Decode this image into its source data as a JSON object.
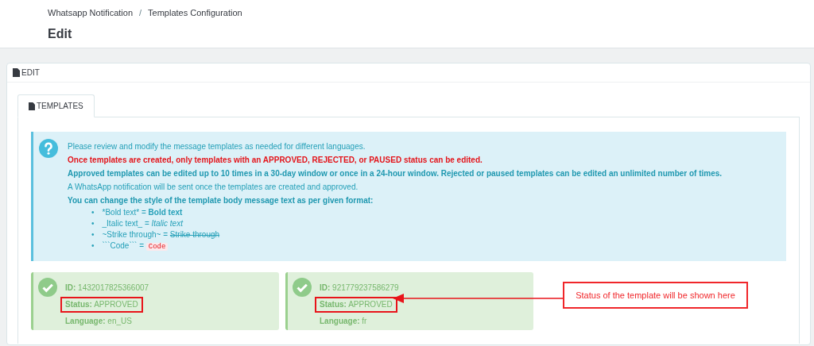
{
  "breadcrumb": [
    "Whatsapp Notification",
    "/",
    "Templates Configuration"
  ],
  "page_title": "Edit",
  "panel": {
    "title": "EDIT"
  },
  "tabs": [
    {
      "label": "TEMPLATES",
      "selected": true
    }
  ],
  "info": {
    "lines": [
      {
        "kind": "plain",
        "text": "Please review and modify the message templates as needed for different languages."
      },
      {
        "kind": "warning",
        "text": "Once templates are created, only templates with an APPROVED, REJECTED, or PAUSED status can be edited."
      },
      {
        "kind": "emphasis",
        "text": "Approved templates can be edited up to 10 times in a 30-day window or once in a 24-hour window. Rejected or paused templates can be edited an unlimited number of times."
      },
      {
        "kind": "plain",
        "text": "A WhatsApp notification will be sent once the templates are created and approved."
      },
      {
        "kind": "emphasis",
        "text": "You can change the style of the template body message text as per given format:"
      }
    ],
    "formats": [
      {
        "bullet": "•",
        "kind": "bold",
        "source": "*Bold text* =",
        "result": "Bold text"
      },
      {
        "bullet": "•",
        "kind": "italic",
        "source": "_Italic text_ =",
        "result": "Italic text"
      },
      {
        "bullet": "•",
        "kind": "strike",
        "source": "~Strike through~ =",
        "result": "Strike through"
      },
      {
        "bullet": "•",
        "kind": "code",
        "source": "```Code``` =",
        "result": "Code"
      }
    ]
  },
  "templates": [
    {
      "id_label": "ID:",
      "id": "1432017825366007",
      "status_label": "Status:",
      "status": "APPROVED",
      "language_label": "Language:",
      "language": "en_US",
      "highlighted": true
    },
    {
      "id_label": "ID:",
      "id": "921779237586279",
      "status_label": "Status:",
      "status": "APPROVED",
      "language_label": "Language:",
      "language": "fr",
      "highlighted": true
    }
  ],
  "annotation": {
    "text": "Status of the template will be shown here"
  }
}
